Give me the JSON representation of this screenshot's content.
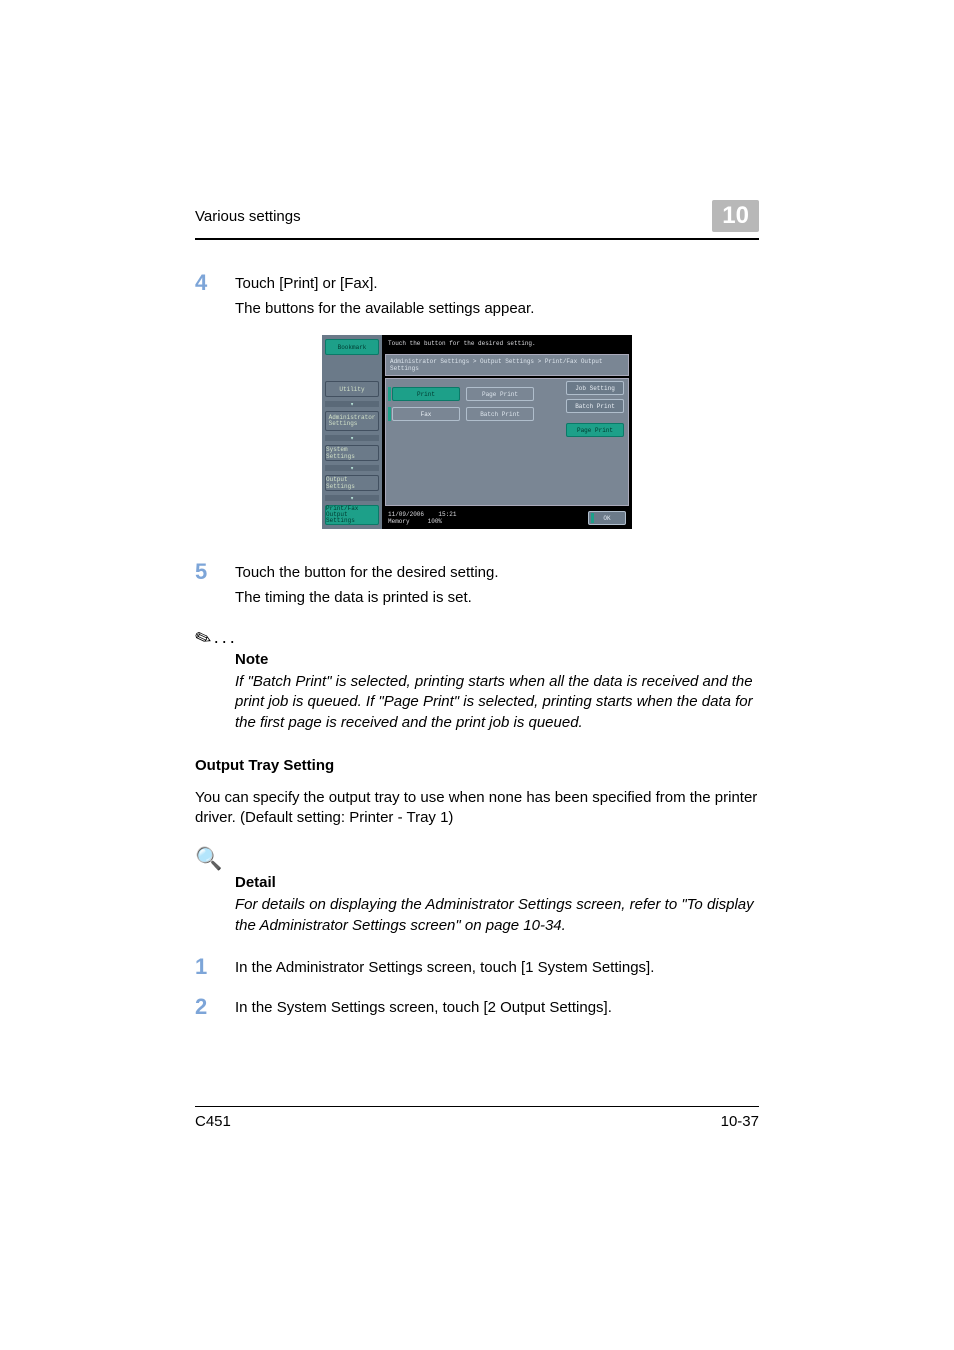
{
  "header": {
    "title": "Various settings",
    "chapter": "10"
  },
  "step4": {
    "num": "4",
    "line1": "Touch [Print] or [Fax].",
    "line2": "The buttons for the available settings appear."
  },
  "mini_screen": {
    "instruction": "Touch the button for the desired setting.",
    "breadcrumb": "Administrator Settings > Output Settings > Print/Fax Output Settings",
    "left": {
      "bookmark": "Bookmark",
      "utility": "Utility",
      "admin": "Administrator\nSettings",
      "system": "System Settings",
      "output": "Output Settings",
      "printfax": "Print/Fax Output\nSettings"
    },
    "body": {
      "print": "Print",
      "page_print_left": "Page Print",
      "fax": "Fax",
      "batch_print_left": "Batch Print",
      "job_setting": "Job Setting",
      "batch_print_right": "Batch Print",
      "page_print_right": "Page Print"
    },
    "footer": {
      "date": "11/09/2006",
      "time": "15:21",
      "memory_label": "Memory",
      "memory_val": "100%",
      "ok": "OK"
    }
  },
  "step5": {
    "num": "5",
    "line1": "Touch the button for the desired setting.",
    "line2": "The timing the data is printed is set."
  },
  "note": {
    "label": "Note",
    "body": "If \"Batch Print\" is selected, printing starts when all the data is received and the print job is queued. If \"Page Print\" is selected, printing starts when the data for the first page is received and the print job is queued."
  },
  "output_tray": {
    "title": "Output Tray Setting",
    "para": "You can specify the output tray to use when none has been specified from the printer driver. (Default setting: Printer - Tray 1)"
  },
  "detail": {
    "label": "Detail",
    "body": "For details on displaying the Administrator Settings screen, refer to \"To display the Administrator Settings screen\" on page 10-34."
  },
  "step1b": {
    "num": "1",
    "line": "In the Administrator Settings screen, touch [1 System Settings]."
  },
  "step2b": {
    "num": "2",
    "line": "In the System Settings screen, touch [2 Output Settings]."
  },
  "footer": {
    "model": "C451",
    "page": "10-37"
  }
}
